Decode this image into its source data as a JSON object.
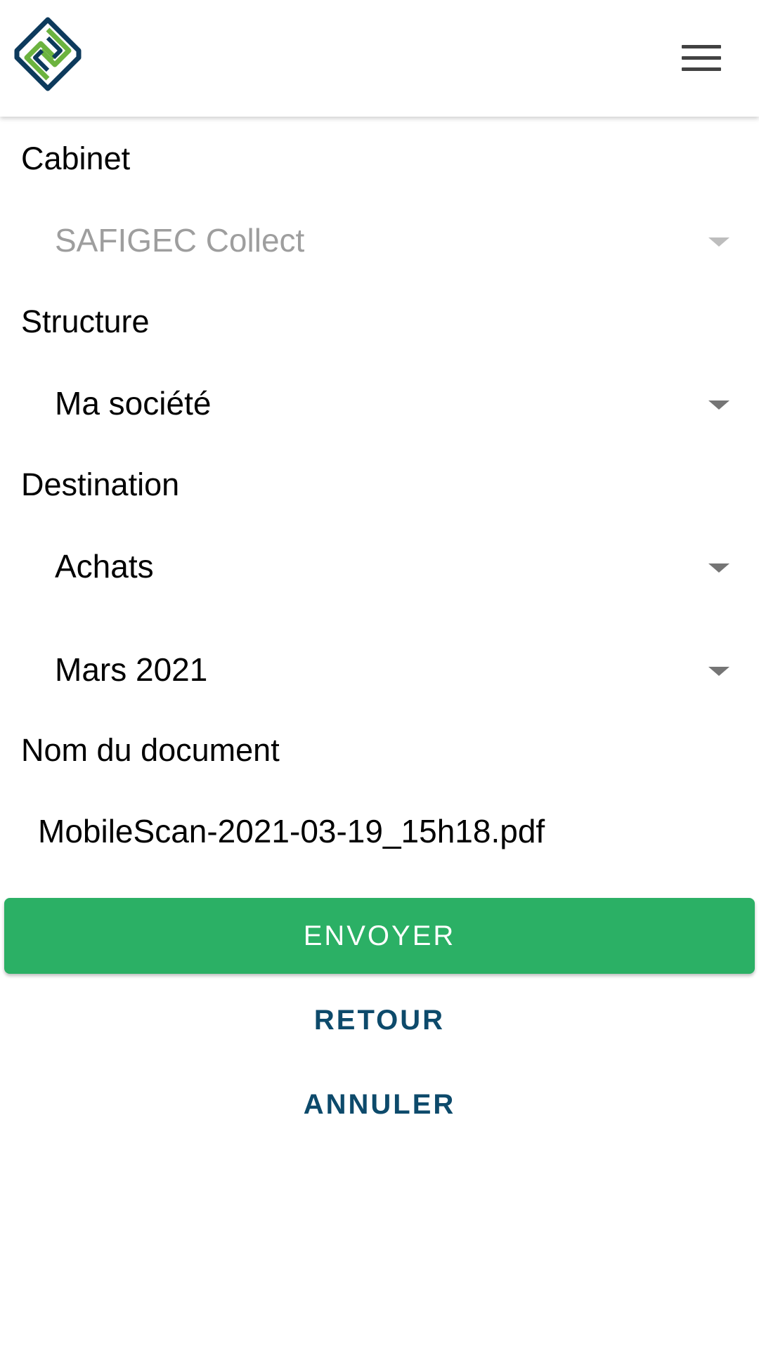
{
  "header": {
    "logo_icon": "safigec-logo-icon",
    "menu_icon": "hamburger-menu-icon"
  },
  "form": {
    "cabinet": {
      "label": "Cabinet",
      "value": "SAFIGEC Collect",
      "disabled": true
    },
    "structure": {
      "label": "Structure",
      "value": "Ma société"
    },
    "destination": {
      "label": "Destination",
      "value": "Achats"
    },
    "period": {
      "value": "Mars 2021"
    },
    "document_name": {
      "label": "Nom du document",
      "value": "MobileScan-2021-03-19_15h18.pdf"
    }
  },
  "actions": {
    "send_label": "ENVOYER",
    "back_label": "RETOUR",
    "cancel_label": "ANNULER"
  },
  "colors": {
    "primary_button": "#2bb065",
    "text_button": "#0d4a6b",
    "logo_navy": "#0d3a5c",
    "logo_green": "#6cb33f"
  }
}
